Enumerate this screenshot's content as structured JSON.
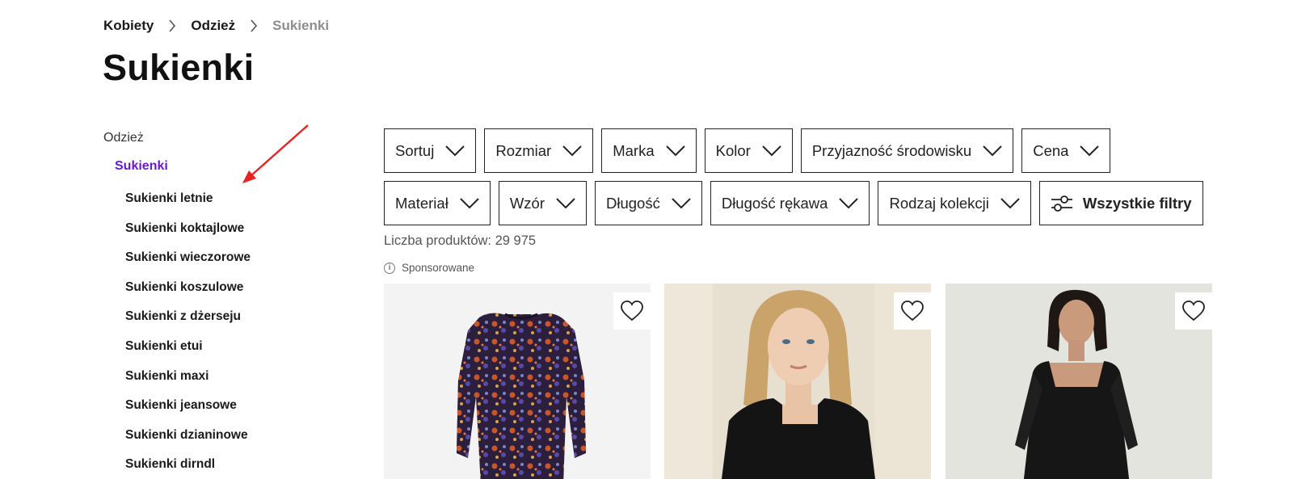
{
  "breadcrumb": {
    "items": [
      "Kobiety",
      "Odzież"
    ],
    "current": "Sukienki"
  },
  "page_title": "Sukienki",
  "sidebar": {
    "parent": "Odzież",
    "active": "Sukienki",
    "items": [
      "Sukienki letnie",
      "Sukienki koktajlowe",
      "Sukienki wieczorowe",
      "Sukienki koszulowe",
      "Sukienki z dżerseju",
      "Sukienki etui",
      "Sukienki maxi",
      "Sukienki jeansowe",
      "Sukienki dzianinowe",
      "Sukienki dirndl"
    ]
  },
  "filters": {
    "row1": [
      "Sortuj",
      "Rozmiar",
      "Marka",
      "Kolor",
      "Przyjazność środowisku",
      "Cena"
    ],
    "row2": [
      "Materiał",
      "Wzór",
      "Długość",
      "Długość rękawa",
      "Rodzaj kolekcji"
    ],
    "all_filters": "Wszystkie filtry"
  },
  "product_count": "Liczba produktów: 29 975",
  "sponsored_label": "Sponsorowane",
  "colors": {
    "accent_purple": "#6a19d6",
    "annotation_red": "#e8231f"
  },
  "icons": {
    "breadcrumb_separator": "chevron-right-icon",
    "filter_dropdown": "chevron-down-icon",
    "all_filters": "sliders-icon",
    "info": "info-icon",
    "wishlist": "heart-icon"
  }
}
